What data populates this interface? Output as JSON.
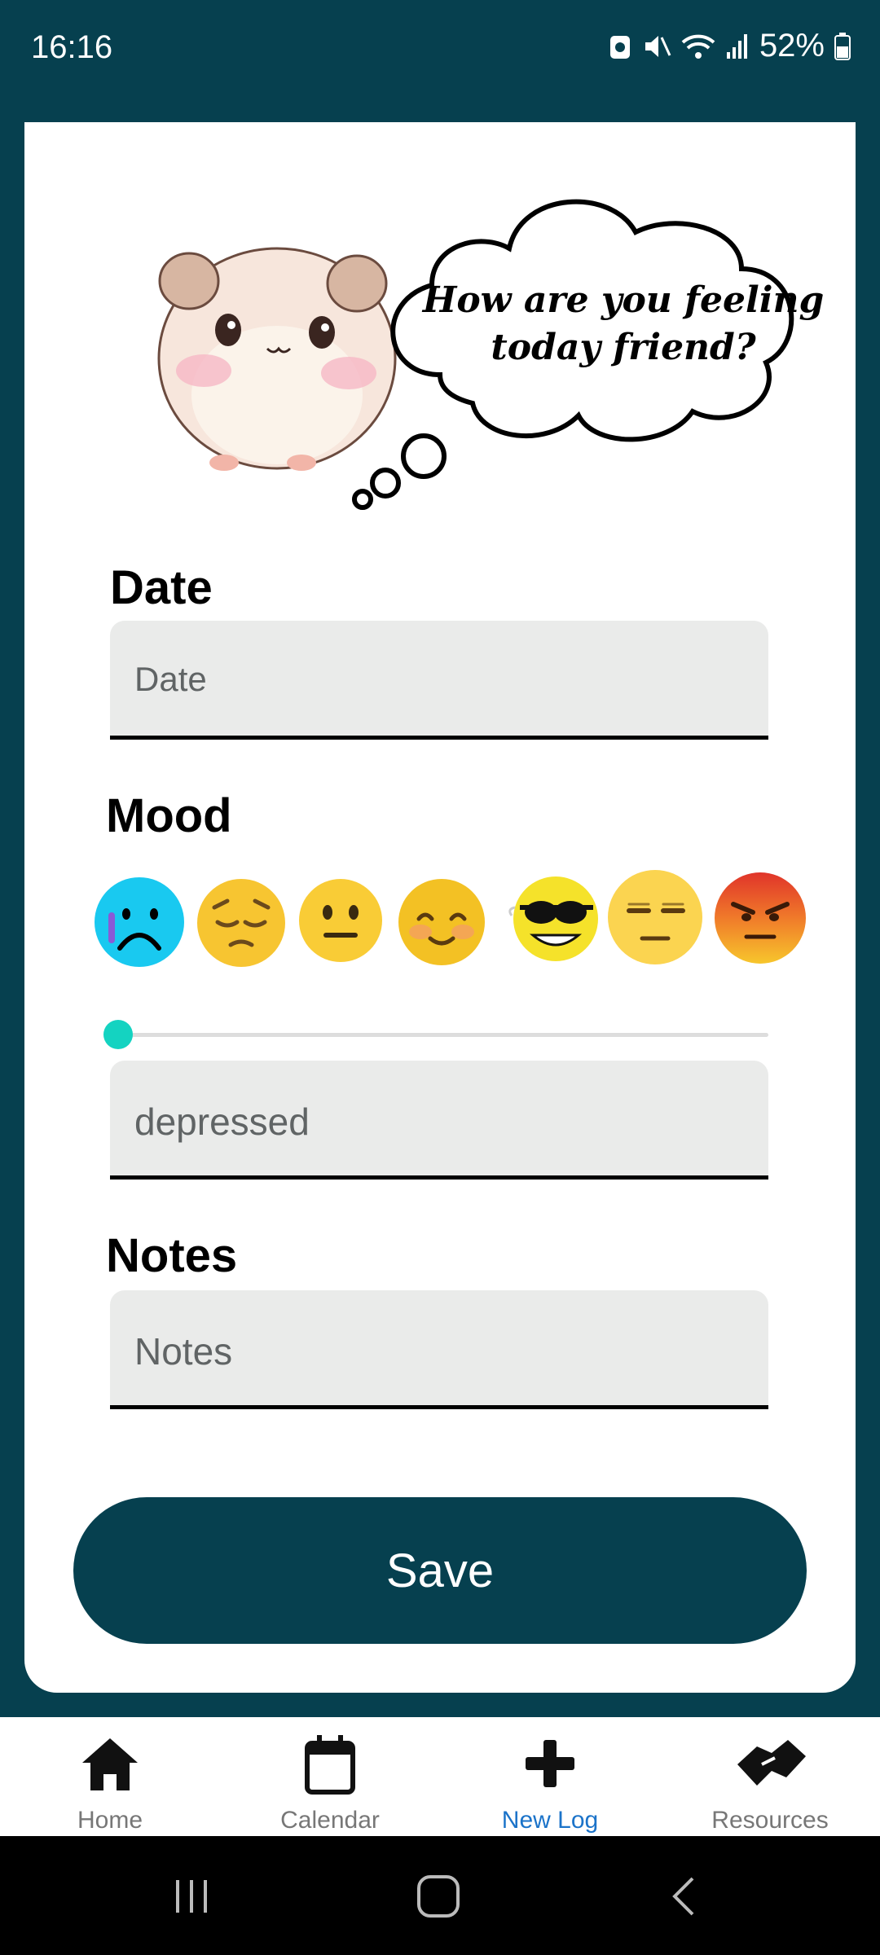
{
  "status_bar": {
    "time": "16:16",
    "battery": "52%"
  },
  "mascot": {
    "thought": "How are you feeling today friend?"
  },
  "date": {
    "label": "Date",
    "placeholder": "Date"
  },
  "mood": {
    "label": "Mood",
    "emojis": [
      "crying-sad-icon",
      "pensive-icon",
      "neutral-icon",
      "smiling-icon",
      "cool-sunglasses-icon",
      "unamused-icon",
      "angry-icon"
    ],
    "slider_value": 0,
    "value": "depressed"
  },
  "notes": {
    "label": "Notes",
    "placeholder": "Notes"
  },
  "save_label": "Save",
  "nav": {
    "items": [
      {
        "label": "Home",
        "icon": "home-icon"
      },
      {
        "label": "Calendar",
        "icon": "calendar-icon"
      },
      {
        "label": "New Log",
        "icon": "plus-icon"
      },
      {
        "label": "Resources",
        "icon": "handshake-icon"
      }
    ],
    "active": "New Log",
    "active_color": "#1b73c9"
  },
  "colors": {
    "background": "#06404f",
    "accent": "#14d3c1"
  }
}
